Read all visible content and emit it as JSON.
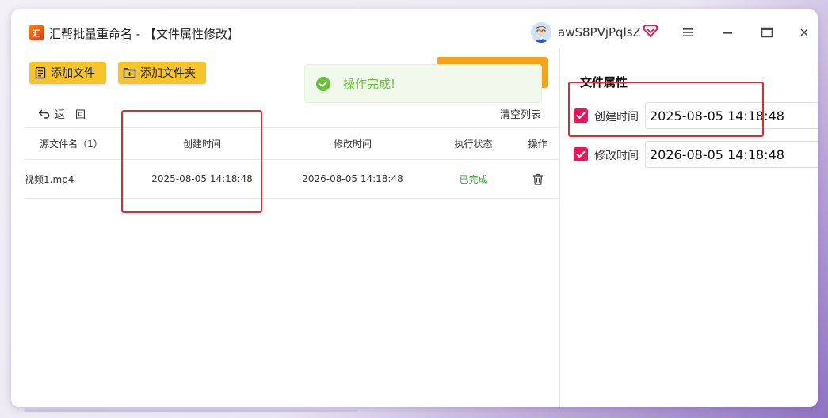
{
  "window": {
    "title": "汇帮批量重命名 - 【文件属性修改】",
    "logo_text": "汇",
    "username": "awS8PVjPqlsZ"
  },
  "toolbar": {
    "add_file_label": "添加文件",
    "add_folder_label": "添加文件夹",
    "back_label": "返　回",
    "clear_list_label": "清空列表"
  },
  "toast": {
    "message": "操作完成!",
    "color": "#67c23a"
  },
  "table": {
    "headers": [
      "源文件名（1）",
      "创建时间",
      "修改时间",
      "执行状态",
      "操作"
    ],
    "rows": [
      {
        "name": "视频1.mp4",
        "created": "2025-08-05 14:18:48",
        "modified": "2026-08-05 14:18:48",
        "status": "已完成",
        "action_icon": "trash-icon"
      }
    ]
  },
  "properties": {
    "title": "文件属性",
    "created_label": "创建时间",
    "created_value": "2025-08-05 14:18:48",
    "created_checked": true,
    "modified_label": "修改时间",
    "modified_value": "2026-08-05 14:18:48",
    "modified_checked": true
  },
  "colors": {
    "accent_button": "#f7c42b",
    "checkbox": "#e6185b",
    "annotation_box": "#e8262b",
    "status_done": "#3aa53a"
  }
}
